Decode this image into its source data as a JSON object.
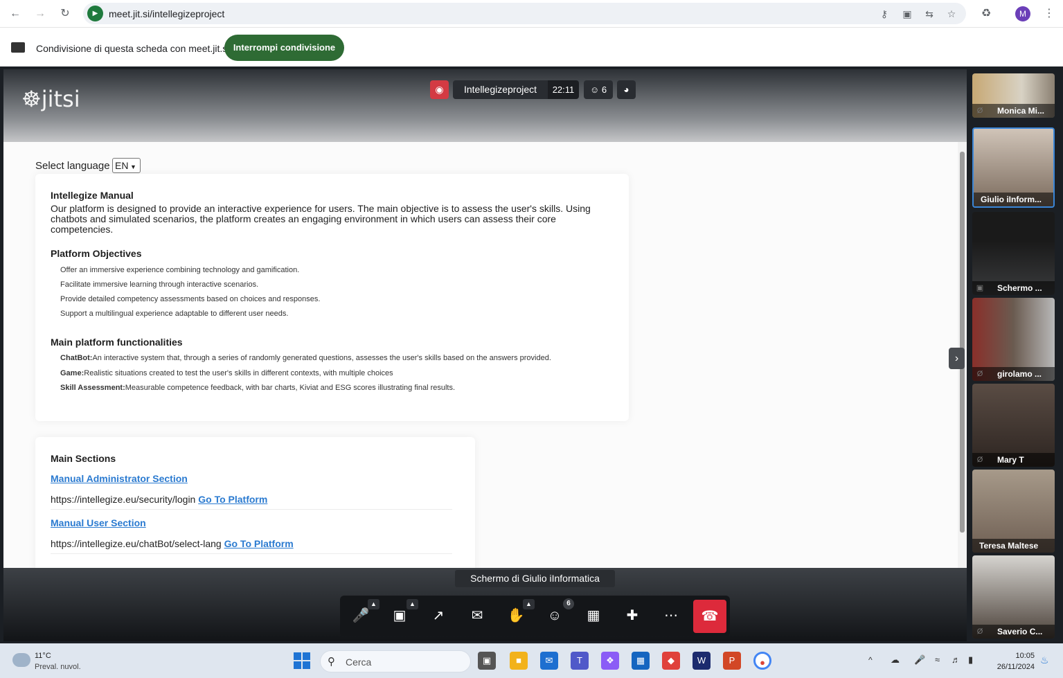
{
  "browser": {
    "url": "meet.jit.si/intellegizeproject",
    "profile_initial": "M"
  },
  "share_bar": {
    "text": "Condivisione di questa scheda con meet.jit.si",
    "stop_label": "Interrompi condivisione"
  },
  "meeting": {
    "logo_text": "jitsi",
    "name": "Intellegizeproject",
    "timer": "22:11",
    "participants_count": "6",
    "screen_label": "Schermo di Giulio iInformatica",
    "participants_badge": "6"
  },
  "manual": {
    "select_language_label": "Select language",
    "language_value": "EN",
    "title": "Intellegize Manual",
    "intro": "Our platform is designed to provide an interactive experience for users. The main objective is to assess the user's skills. Using chatbots and simulated scenarios, the platform creates an engaging environment in which users can assess their core competencies.",
    "objectives_title": "Platform Objectives",
    "objectives": [
      "Offer an immersive experience combining technology and gamification.",
      "Facilitate immersive learning through interactive scenarios.",
      "Provide detailed competency assessments based on choices and responses.",
      "Support a multilingual experience adaptable to different user needs."
    ],
    "functionalities_title": "Main platform functionalities",
    "functionalities": [
      {
        "name": "ChatBot:",
        "desc": "An interactive system that, through a series of randomly generated questions, assesses the user's skills based on the answers provided."
      },
      {
        "name": "Game:",
        "desc": "Realistic situations created to test the user's skills in different contexts, with multiple choices"
      },
      {
        "name": "Skill Assessment:",
        "desc": "Measurable competence feedback, with bar charts, Kiviat and ESG scores illustrating final results."
      }
    ],
    "sections_title": "Main Sections",
    "admin_section_link": "Manual Administrator Section",
    "admin_url": "https://intellegize.eu/security/login",
    "user_section_link": "Manual User Section",
    "user_url": "https://intellegize.eu/chatBot/select-lang",
    "go_to_platform": "Go To Platform"
  },
  "participants": [
    {
      "name": "Monica Mi...",
      "muted": true
    },
    {
      "name": "Giulio iInform...",
      "muted": false
    },
    {
      "name": "Schermo ...",
      "muted": false,
      "screen": true
    },
    {
      "name": "girolamo ...",
      "muted": true
    },
    {
      "name": "Mary T",
      "muted": true
    },
    {
      "name": "Teresa Maltese",
      "muted": false
    },
    {
      "name": "Saverio C...",
      "muted": true
    }
  ],
  "taskbar": {
    "temperature": "11°C",
    "weather": "Preval. nuvol.",
    "search_placeholder": "Cerca",
    "time": "10:05",
    "date": "26/11/2024"
  }
}
